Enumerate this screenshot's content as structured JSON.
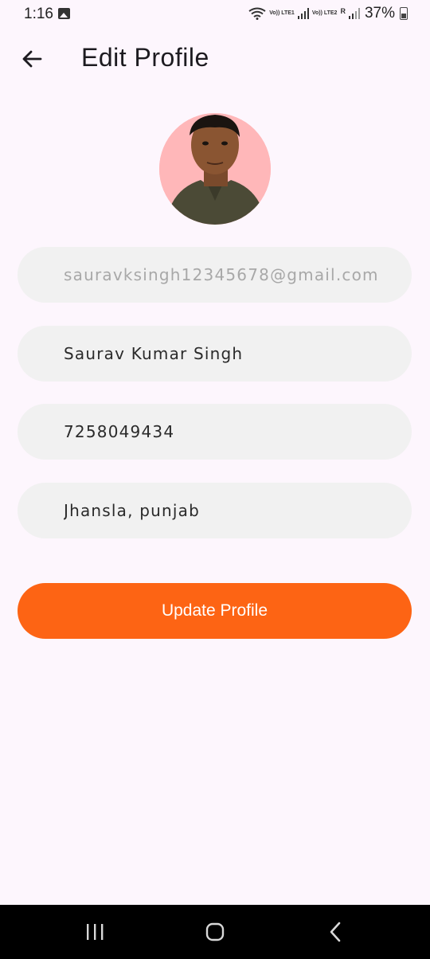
{
  "status_bar": {
    "time": "1:16",
    "net_sim1": "Vo)) LTE1",
    "net_sim2": "Vo)) LTE2",
    "roaming": "R",
    "battery": "37%"
  },
  "header": {
    "title": "Edit Profile",
    "back_icon": "arrow-left-icon"
  },
  "profile": {
    "avatar_bg": "#ffb7b9"
  },
  "form": {
    "email": "sauravksingh12345678@gmail.com",
    "name": "Saurav Kumar Singh",
    "phone": "7258049434",
    "address": "Jhansla, punjab"
  },
  "actions": {
    "update_label": "Update Profile",
    "accent_color": "#fd6414"
  },
  "nav_bar": {
    "icons": [
      "recent-apps-icon",
      "home-icon",
      "back-icon"
    ]
  }
}
